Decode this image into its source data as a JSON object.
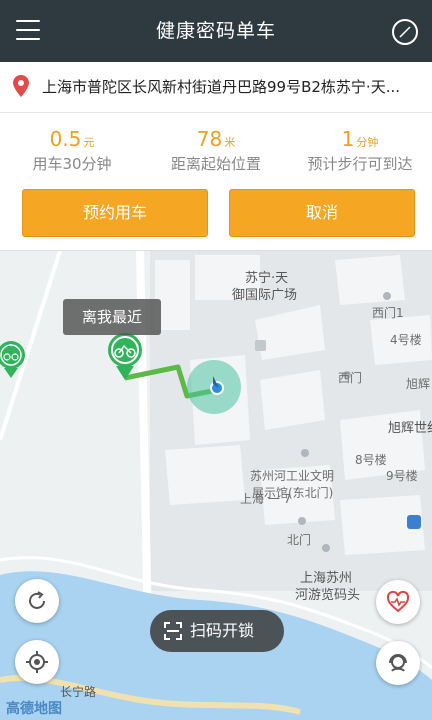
{
  "header": {
    "title": "健康密码单车"
  },
  "address": {
    "text": "上海市普陀区长风新村街道丹巴路99号B2栋苏宁·天..."
  },
  "stats": [
    {
      "value": "0.5",
      "unit": "元",
      "label": "用车30分钟"
    },
    {
      "value": "78",
      "unit": "米",
      "label": "距离起始位置"
    },
    {
      "value": "1",
      "unit": "分钟",
      "label": "预计步行可到达"
    }
  ],
  "actions": {
    "reserve_label": "预约用车",
    "cancel_label": "取消"
  },
  "map": {
    "bubble_text": "离我最近",
    "scan_label": "扫码开锁",
    "logo_text": "高德地图",
    "labels": {
      "building_main": "苏宁·天",
      "building_main2": "御国际广场",
      "gate_west1": "西门1",
      "building4": "4号楼",
      "gate_west": "西门",
      "xuhui1": "旭辉",
      "xuhui2": "旭辉世纪",
      "building8": "8号楼",
      "building9": "9号楼",
      "museum1": "苏州河工业文明",
      "museum2": "展示馆(东北门)",
      "gate_north": "北门",
      "pier1": "上海苏州",
      "pier2": "河游览码头",
      "road": "长宁路",
      "top_text": "上海 一 7"
    }
  },
  "colors": {
    "header_bg": "#2f3a40",
    "accent": "#f5a623",
    "bike_green": "#2eb45a"
  }
}
